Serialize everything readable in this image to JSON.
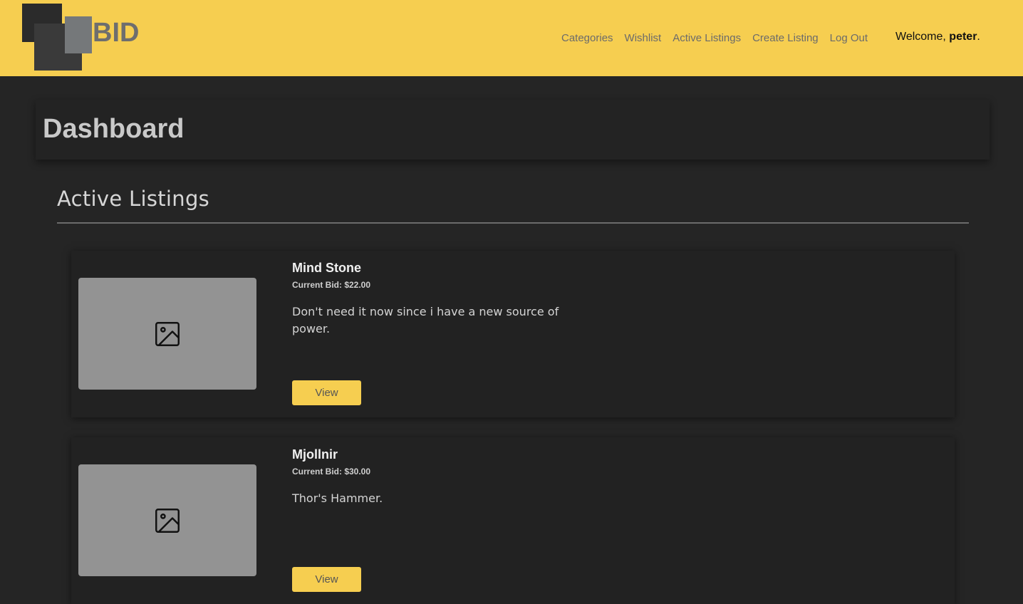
{
  "header": {
    "logo_text": "BID",
    "nav": [
      "Categories",
      "Wishlist",
      "Active Listings",
      "Create Listing",
      "Log Out"
    ],
    "welcome_prefix": "Welcome,",
    "username": "peter",
    "welcome_suffix": "."
  },
  "dashboard": {
    "title": "Dashboard"
  },
  "section": {
    "title": "Active Listings"
  },
  "listings": [
    {
      "title": "Mind Stone",
      "current_bid": "Current Bid: $22.00",
      "description": "Don't need it now since i have a new source of power.",
      "button": "View",
      "image_icon": "image-placeholder-icon"
    },
    {
      "title": "Mjollnir",
      "current_bid": "Current Bid: $30.00",
      "description": "Thor's Hammer.",
      "button": "View",
      "image_icon": "image-placeholder-icon"
    }
  ],
  "colors": {
    "accent": "#f6ce50",
    "background": "#252525",
    "card": "#222222"
  }
}
